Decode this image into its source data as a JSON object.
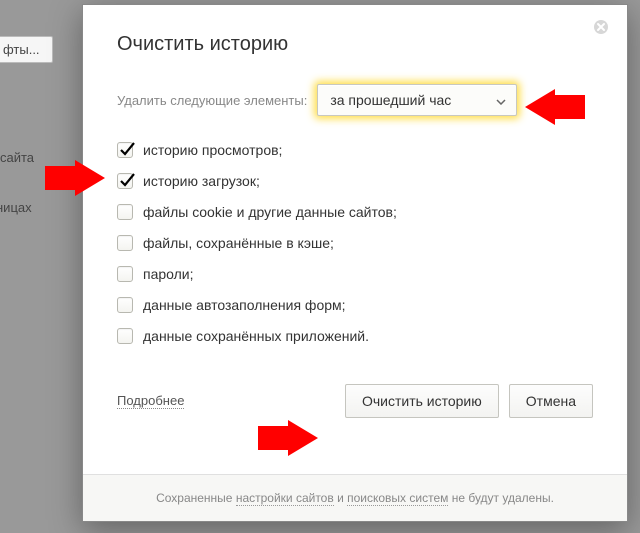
{
  "bg": {
    "fonts_btn": "фты...",
    "text_a": "сайта",
    "text_b": "ницах"
  },
  "dialog": {
    "title": "Очистить историю",
    "time_label": "Удалить следующие элементы:",
    "select_value": "за прошедший час",
    "items": [
      {
        "label": "историю просмотров;",
        "checked": true
      },
      {
        "label": "историю загрузок;",
        "checked": true
      },
      {
        "label": "файлы cookie и другие данные сайтов;",
        "checked": false
      },
      {
        "label": "файлы, сохранённые в кэше;",
        "checked": false
      },
      {
        "label": "пароли;",
        "checked": false
      },
      {
        "label": "данные автозаполнения форм;",
        "checked": false
      },
      {
        "label": "данные сохранённых приложений.",
        "checked": false
      }
    ],
    "more": "Подробнее",
    "clear_btn": "Очистить историю",
    "cancel_btn": "Отмена",
    "footer_pre": "Сохраненные ",
    "footer_link1": "настройки сайтов",
    "footer_mid": " и ",
    "footer_link2": "поисковых систем",
    "footer_post": " не будут удалены."
  }
}
